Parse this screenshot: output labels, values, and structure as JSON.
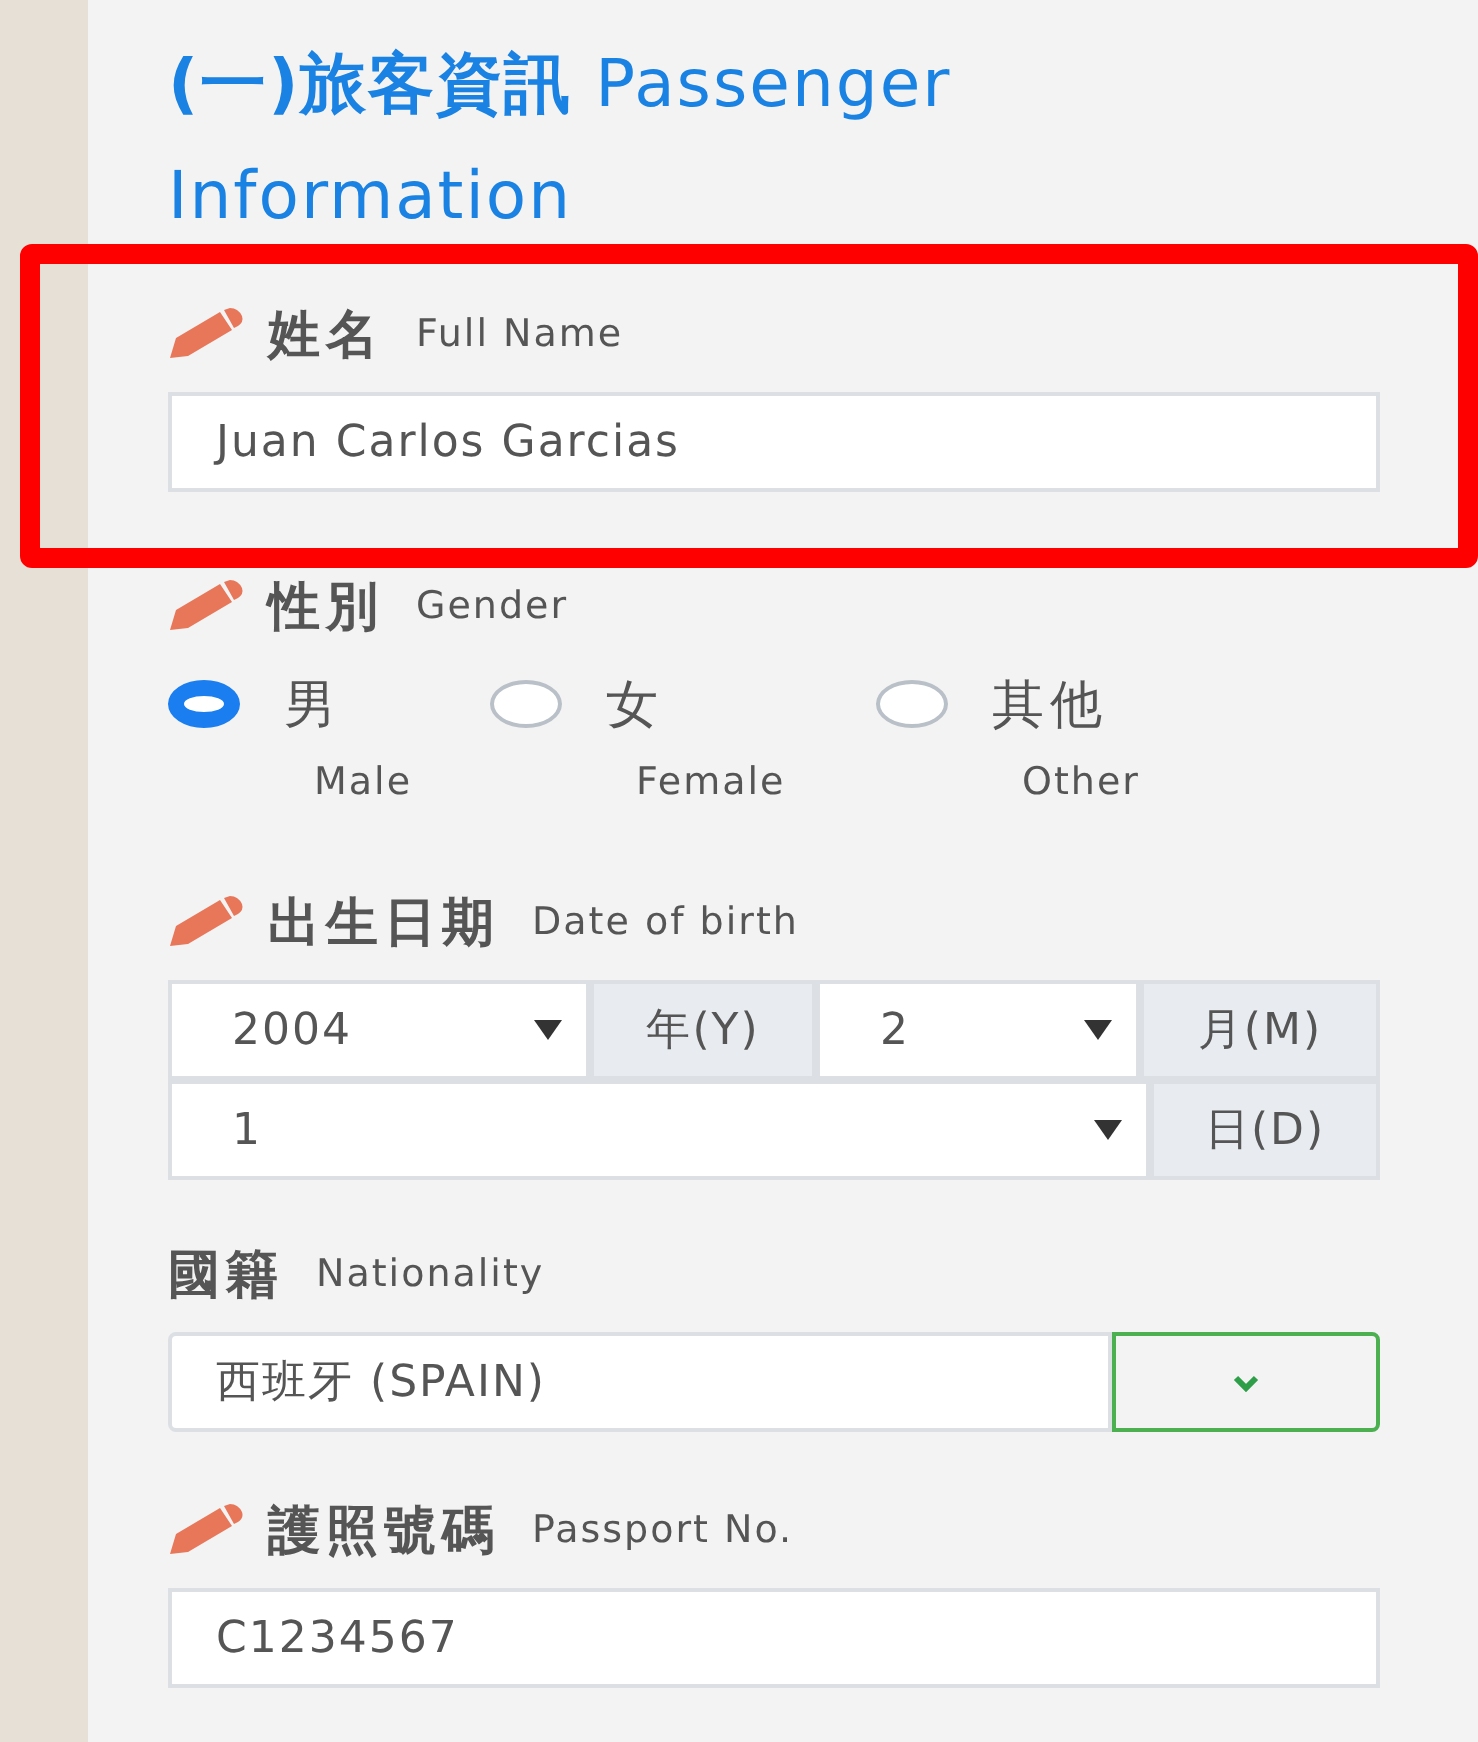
{
  "title": {
    "zh": "(一)旅客資訊",
    "en": "Passenger Information"
  },
  "fields": [
    {
      "kind": "text",
      "required": true,
      "highlighted": true,
      "label_zh": "姓名",
      "label_en": "Full Name",
      "value": "Juan Carlos Garcias"
    },
    {
      "kind": "radio",
      "required": true,
      "highlighted": false,
      "label_zh": "性別",
      "label_en": "Gender",
      "options": [
        {
          "zh": "男",
          "en": "Male",
          "selected": true
        },
        {
          "zh": "女",
          "en": "Female",
          "selected": false
        },
        {
          "zh": "其他",
          "en": "Other",
          "selected": false
        }
      ]
    },
    {
      "kind": "date",
      "required": true,
      "highlighted": false,
      "label_zh": "出生日期",
      "label_en": "Date of birth",
      "parts": [
        {
          "value": "2004",
          "unit": "年(Y)"
        },
        {
          "value": "2",
          "unit": "月(M)"
        },
        {
          "value": "1",
          "unit": "日(D)"
        }
      ]
    },
    {
      "kind": "select",
      "required": false,
      "highlighted": false,
      "label_zh": "國籍",
      "label_en": "Nationality",
      "value": "西班牙 (SPAIN)"
    },
    {
      "kind": "text",
      "required": true,
      "highlighted": false,
      "label_zh": "護照號碼",
      "label_en": "Passport No.",
      "value": "C1234567"
    }
  ]
}
